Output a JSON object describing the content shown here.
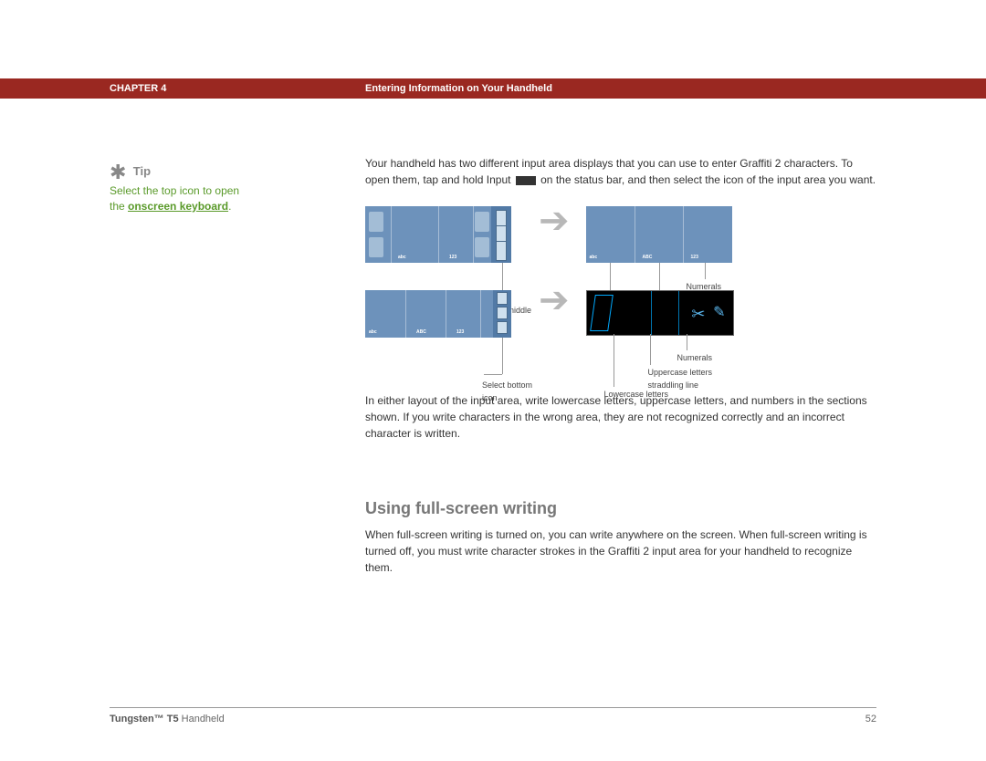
{
  "header": {
    "chapter": "CHAPTER 4",
    "title": "Entering Information on Your Handheld"
  },
  "tip": {
    "label": "Tip",
    "body_prefix": "Select the top icon to open the ",
    "link": "onscreen keyboard",
    "body_suffix": "."
  },
  "body": {
    "p1a": "Your handheld has two different input area displays that you can use to enter Graffiti 2 characters. To open them, tap and hold Input ",
    "p1b": " on the status bar, and then select the icon of the input area you want.",
    "p2": "In either layout of the input area, write lowercase letters, uppercase letters, and numbers in the sections shown. If you write characters in the wrong area, they are not recognized correctly and an incorrect character is written.",
    "h2": "Using full-screen writing",
    "p3": "When full-screen writing is turned on, you can write anywhere on the screen. When full-screen writing is turned off, you must write character strokes in the Graffiti 2 input area for your handheld to recognize them."
  },
  "labels": {
    "abc_lower": "abc",
    "abc_upper": "ABC",
    "num": "123",
    "select_middle": "Select middle icon",
    "select_bottom": "Select bottom icon",
    "numerals": "Numerals",
    "uppercase": "Uppercase letters",
    "lowercase": "Lowercase letters",
    "upper_straddle": "Uppercase letters straddling line"
  },
  "footer": {
    "product_bold": "Tungsten™ T5",
    "product_rest": " Handheld",
    "page": "52"
  }
}
